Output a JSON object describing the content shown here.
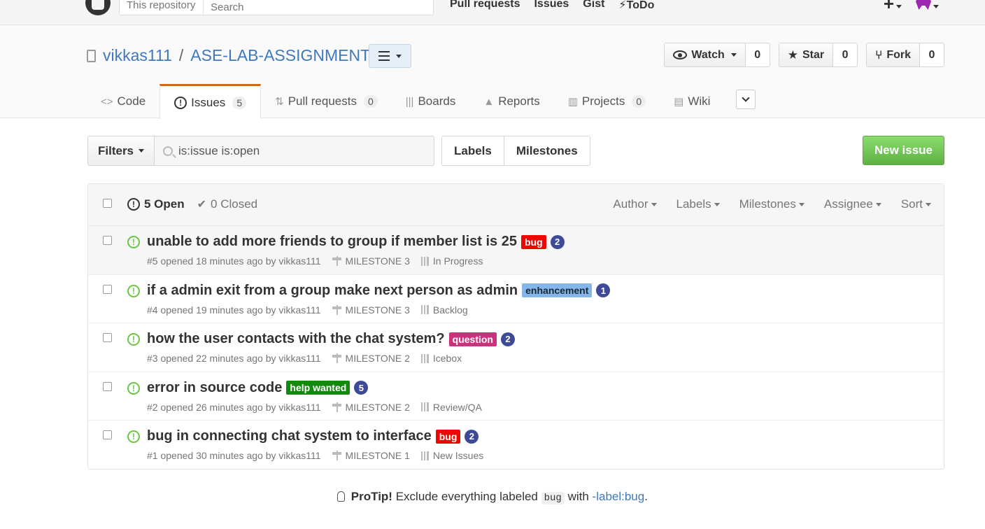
{
  "header": {
    "search_scope": "This repository",
    "search_placeholder": "Search",
    "nav": [
      "Pull requests",
      "Issues",
      "Gist",
      "ToDo"
    ],
    "todo_icon": "bolt-icon"
  },
  "repo": {
    "owner": "vikkas111",
    "separator": "/",
    "name": "ASE-LAB-ASSIGNMENTS",
    "watch_label": "Watch",
    "watch_count": "0",
    "star_label": "Star",
    "star_count": "0",
    "fork_label": "Fork",
    "fork_count": "0"
  },
  "reponav": {
    "code": "Code",
    "issues": "Issues",
    "issues_count": "5",
    "pulls": "Pull requests",
    "pulls_count": "0",
    "boards": "Boards",
    "reports": "Reports",
    "projects": "Projects",
    "projects_count": "0",
    "wiki": "Wiki"
  },
  "subnav": {
    "filters_label": "Filters",
    "search_value": "is:issue is:open",
    "labels": "Labels",
    "milestones": "Milestones",
    "new_issue": "New issue"
  },
  "issues_header": {
    "open": "5 Open",
    "closed": "0 Closed",
    "filters": [
      "Author",
      "Labels",
      "Milestones",
      "Assignee",
      "Sort"
    ]
  },
  "issues": [
    {
      "title": "unable to add more friends to group if member list is 25",
      "label": "bug",
      "label_class": "bug",
      "badge": "2",
      "meta": "#5 opened 18 minutes ago by vikkas111",
      "milestone": "MILESTONE 3",
      "board": "In Progress"
    },
    {
      "title": "if a admin exit from a group make next person as admin",
      "label": "enhancement",
      "label_class": "enhancement",
      "badge": "1",
      "meta": "#4 opened 19 minutes ago by vikkas111",
      "milestone": "MILESTONE 3",
      "board": "Backlog"
    },
    {
      "title": "how the user contacts with the chat system?",
      "label": "question",
      "label_class": "question",
      "badge": "2",
      "meta": "#3 opened 22 minutes ago by vikkas111",
      "milestone": "MILESTONE 2",
      "board": "Icebox"
    },
    {
      "title": "error in source code",
      "label": "help wanted",
      "label_class": "help",
      "badge": "5",
      "meta": "#2 opened 26 minutes ago by vikkas111",
      "milestone": "MILESTONE 2",
      "board": "Review/QA"
    },
    {
      "title": "bug in connecting chat system to interface",
      "label": "bug",
      "label_class": "bug",
      "badge": "2",
      "meta": "#1 opened 30 minutes ago by vikkas111",
      "milestone": "MILESTONE 1",
      "board": "New Issues"
    }
  ],
  "protip": {
    "prefix": "ProTip!",
    "text1": "Exclude everything labeled",
    "code": "bug",
    "text2": "with",
    "link": "-label:bug",
    "suffix": "."
  },
  "colors": {
    "accent_link": "#4078c0",
    "tab_active": "#d26911",
    "open_green": "#6cc644",
    "new_issue_green": "#60b044",
    "label_bug": "#ee0701",
    "label_enhancement": "#84b6eb",
    "label_question": "#cc317c",
    "label_help_wanted": "#128a0c"
  }
}
